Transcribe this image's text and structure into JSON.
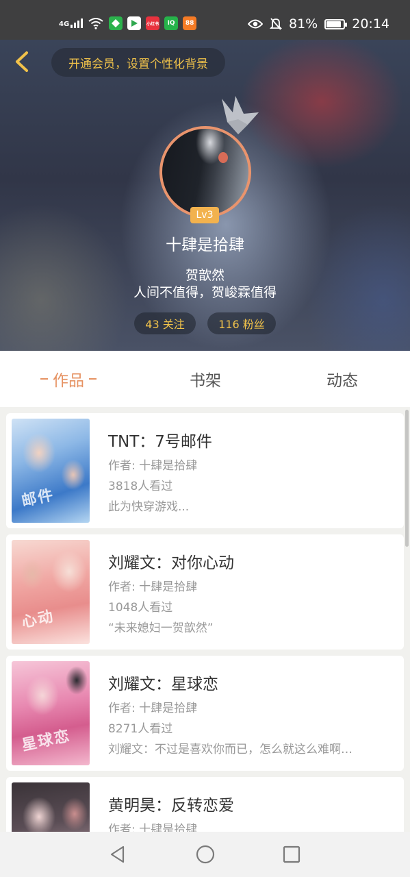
{
  "status_bar": {
    "network": "4G",
    "app_icons": [
      {
        "name": "wechat-pay-icon",
        "text": "",
        "color": "#2bb24c"
      },
      {
        "name": "video-player-icon",
        "text": "",
        "color": "#ffffff"
      },
      {
        "name": "xiaohongshu-icon",
        "text": "小红书",
        "color": "#e8323e"
      },
      {
        "name": "iqiyi-icon",
        "text": "iQ",
        "color": "#26b34a"
      },
      {
        "name": "taobao-special-icon",
        "text": "88",
        "color": "#f57b25"
      }
    ],
    "battery": "81%",
    "battery_level": 0.81,
    "time": "20:14"
  },
  "header": {
    "vip_banner": "开通会员，设置个性化背景",
    "level": "Lv3",
    "username": "十肆是拾肆",
    "bio_line1": "贺歆然",
    "bio_line2": "人间不值得，贺峻霖值得",
    "following": "43 关注",
    "fans": "116 粉丝"
  },
  "tabs": {
    "works": "作品",
    "shelf": "书架",
    "feed": "动态"
  },
  "works": [
    {
      "title": "TNT：7号邮件",
      "author": "作者: 十肆是拾肆",
      "views": "3818人看过",
      "desc": "此为快穿游戏...",
      "cover_text": "邮件"
    },
    {
      "title": "刘耀文：对你心动",
      "author": "作者: 十肆是拾肆",
      "views": "1048人看过",
      "desc": "“未来媳妇一贺歆然”",
      "cover_text": "心动"
    },
    {
      "title": "刘耀文：星球恋",
      "author": "作者: 十肆是拾肆",
      "views": "8271人看过",
      "desc": "刘耀文：不过是喜欢你而已，怎么就这么难啊…",
      "cover_text": "星球恋"
    },
    {
      "title": "黄明昊：反转恋爱",
      "author": "作者: 十肆是拾肆",
      "views": "",
      "desc": "",
      "cover_text": ""
    }
  ],
  "colors": {
    "accent": "#e69262",
    "gold": "#f0c24a",
    "level_badge": "#f2b24e"
  }
}
